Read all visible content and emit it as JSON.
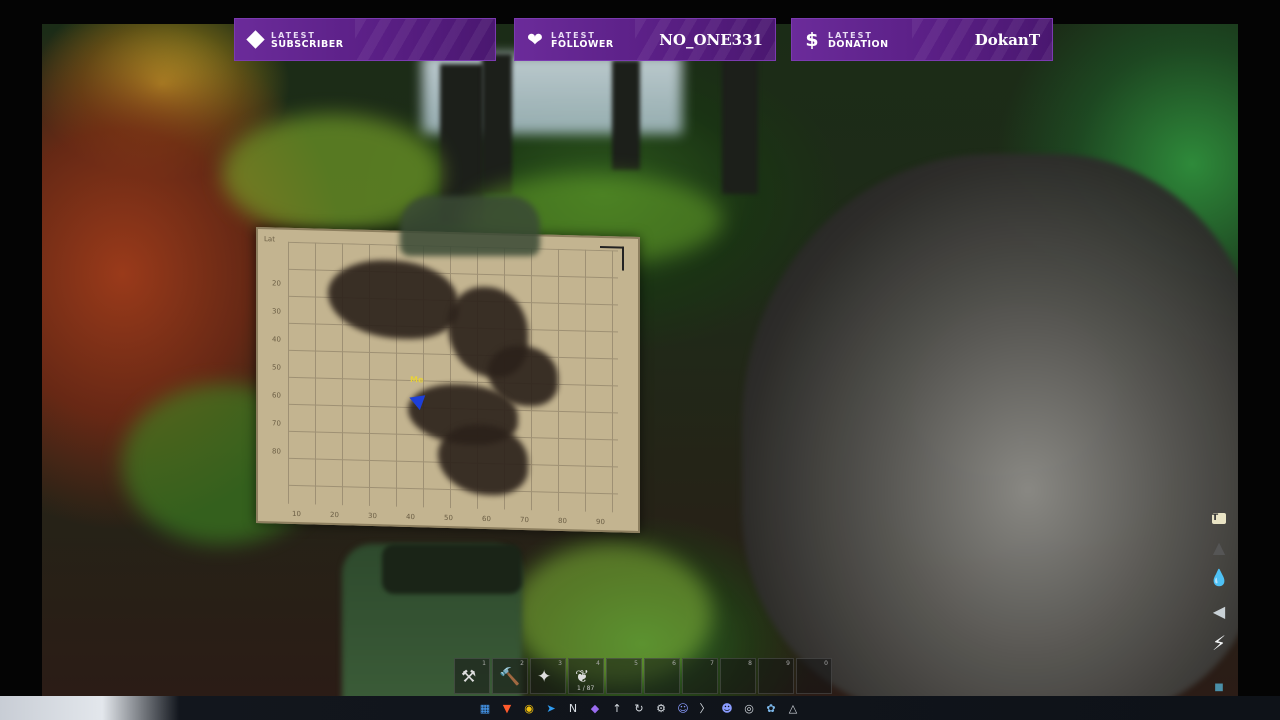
{
  "alerts": [
    {
      "line1": "LATEST",
      "line2": "SUBSCRIBER",
      "value": "",
      "icon": "diamond-icon"
    },
    {
      "line1": "LATEST",
      "line2": "FOLLOWER",
      "value": "NO_ONE331",
      "icon": "heart-icon"
    },
    {
      "line1": "LATEST",
      "line2": "DONATION",
      "value": "DokanT",
      "icon": "dollar-icon"
    }
  ],
  "map": {
    "player_label": "Me",
    "ticks_left": [
      "Lat",
      "20",
      "30",
      "40",
      "50",
      "60",
      "70",
      "80"
    ],
    "ticks_bottom": [
      "10",
      "20",
      "30",
      "40",
      "50",
      "60",
      "70",
      "80",
      "90"
    ]
  },
  "hud": {
    "icons": [
      "temperature-badge-icon",
      "weight-icon",
      "water-drop-icon",
      "food-icon",
      "stamina-bolt-icon",
      "status-square-icon"
    ],
    "badge_text": "T"
  },
  "hotbar": {
    "slots": [
      {
        "num": "1",
        "icon": "pickaxe-icon",
        "qty": ""
      },
      {
        "num": "2",
        "icon": "hatchet-icon",
        "qty": ""
      },
      {
        "num": "3",
        "icon": "sickle-icon",
        "qty": ""
      },
      {
        "num": "4",
        "icon": "torch-icon",
        "qty": "1 / 87"
      },
      {
        "num": "5",
        "icon": "",
        "qty": ""
      },
      {
        "num": "6",
        "icon": "",
        "qty": ""
      },
      {
        "num": "7",
        "icon": "",
        "qty": ""
      },
      {
        "num": "8",
        "icon": "",
        "qty": ""
      },
      {
        "num": "9",
        "icon": "",
        "qty": ""
      },
      {
        "num": "0",
        "icon": "",
        "qty": ""
      }
    ]
  },
  "taskbar": {
    "icons": [
      "windows-start-icon",
      "brave-icon",
      "chrome-icon",
      "vscode-icon",
      "notion-icon",
      "obsidian-icon",
      "upload-icon",
      "refresh-icon",
      "settings-icon",
      "discord-icon",
      "terminal-icon",
      "discord-alt-icon",
      "game-icon",
      "steam-icon",
      "arrow-app-icon"
    ]
  },
  "colors": {
    "alert_bg": "#5a1f85",
    "alert_border": "#7b3ab0",
    "map_paper": "#c3b490",
    "player_marker": "#1d3fd8",
    "player_label": "#e8d23a"
  }
}
